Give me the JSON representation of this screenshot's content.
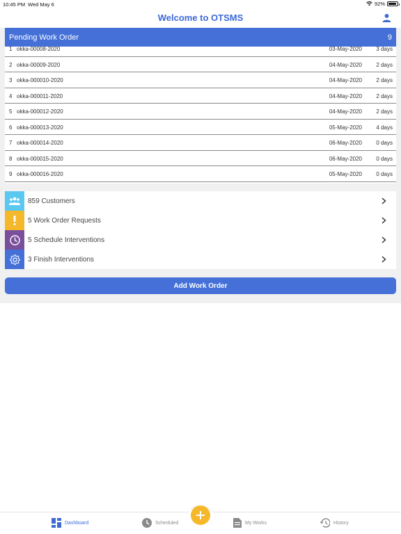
{
  "status_bar": {
    "time": "10:45 PM",
    "date": "Wed May 6",
    "battery": "92%",
    "battery_level": 0.92
  },
  "header": {
    "title": "Welcome to OTSMS",
    "profile_icon": "person-icon"
  },
  "pending": {
    "title": "Pending Work Order",
    "count": "9",
    "rows": [
      {
        "index": "1",
        "code": "okka-00008-2020",
        "date": "03-May-2020",
        "days": "3 days"
      },
      {
        "index": "2",
        "code": "okka-00009-2020",
        "date": "04-May-2020",
        "days": "2 days"
      },
      {
        "index": "3",
        "code": "okka-000010-2020",
        "date": "04-May-2020",
        "days": "2 days"
      },
      {
        "index": "4",
        "code": "okka-000011-2020",
        "date": "04-May-2020",
        "days": "2 days"
      },
      {
        "index": "5",
        "code": "okka-000012-2020",
        "date": "04-May-2020",
        "days": "2 days"
      },
      {
        "index": "6",
        "code": "okka-000013-2020",
        "date": "05-May-2020",
        "days": "4 days"
      },
      {
        "index": "7",
        "code": "okka-000014-2020",
        "date": "06-May-2020",
        "days": "0 days"
      },
      {
        "index": "8",
        "code": "okka-000015-2020",
        "date": "06-May-2020",
        "days": "0 days"
      },
      {
        "index": "9",
        "code": "okka-000016-2020",
        "date": "05-May-2020",
        "days": "0 days"
      }
    ]
  },
  "summary": [
    {
      "label": "859 Customers",
      "icon": "group-icon",
      "color": "#5bc8f0"
    },
    {
      "label": "5 Work Order Requests",
      "icon": "exclamation-icon",
      "color": "#f5b82a"
    },
    {
      "label": "5 Schedule Interventions",
      "icon": "clock-icon",
      "color": "#7a4f9c"
    },
    {
      "label": "3 Finish Interventions",
      "icon": "gear-icon",
      "color": "#4470d8"
    }
  ],
  "add_button": {
    "label": "Add Work Order"
  },
  "tabs": [
    {
      "label": "Dashboard",
      "icon": "dashboard-icon",
      "active": true
    },
    {
      "label": "Scheduled",
      "icon": "clock-icon",
      "active": false
    },
    {
      "label": "My Works",
      "icon": "document-icon",
      "active": false
    },
    {
      "label": "History",
      "icon": "history-icon",
      "active": false
    }
  ],
  "fab": {
    "icon": "plus-icon"
  },
  "colors": {
    "primary": "#4470d8",
    "accent": "#f5b82a",
    "background": "#f0f0f0"
  }
}
